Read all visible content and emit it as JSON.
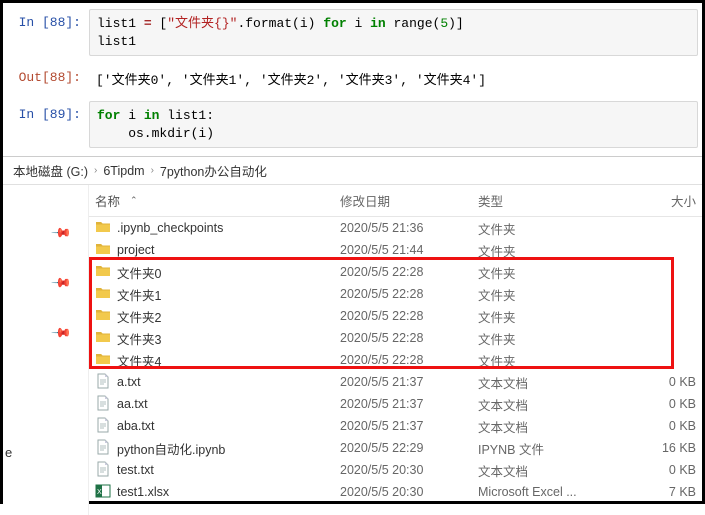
{
  "cells": {
    "in88_prompt": "In  [88]:",
    "in88_code_html": "list1 <span class='tok-op'>=</span> [<span class='tok-str'>\"文件夹{}\"</span>.format(i) <span class='tok-kw'>for</span> i <span class='tok-kw'>in</span> range(<span class='tok-num'>5</span>)]\nlist1",
    "out88_prompt": "Out[88]:",
    "out88_text": "['文件夹0', '文件夹1', '文件夹2', '文件夹3', '文件夹4']",
    "in89_prompt": "In  [89]:",
    "in89_code_html": "<span class='tok-kw'>for</span> i <span class='tok-kw'>in</span> list1:\n    os.mkdir(i)"
  },
  "breadcrumb": {
    "items": [
      "本地磁盘 (G:)",
      "6Tipdm",
      "7python办公自动化"
    ]
  },
  "columns": {
    "name": "名称",
    "date": "修改日期",
    "type": "类型",
    "size": "大小"
  },
  "files": [
    {
      "icon": "folder",
      "name": ".ipynb_checkpoints",
      "date": "2020/5/5 21:36",
      "type": "文件夹",
      "size": ""
    },
    {
      "icon": "folder",
      "name": "project",
      "date": "2020/5/5 21:44",
      "type": "文件夹",
      "size": ""
    },
    {
      "icon": "folder",
      "name": "文件夹0",
      "date": "2020/5/5 22:28",
      "type": "文件夹",
      "size": ""
    },
    {
      "icon": "folder",
      "name": "文件夹1",
      "date": "2020/5/5 22:28",
      "type": "文件夹",
      "size": ""
    },
    {
      "icon": "folder",
      "name": "文件夹2",
      "date": "2020/5/5 22:28",
      "type": "文件夹",
      "size": ""
    },
    {
      "icon": "folder",
      "name": "文件夹3",
      "date": "2020/5/5 22:28",
      "type": "文件夹",
      "size": ""
    },
    {
      "icon": "folder",
      "name": "文件夹4",
      "date": "2020/5/5 22:28",
      "type": "文件夹",
      "size": ""
    },
    {
      "icon": "txt",
      "name": "a.txt",
      "date": "2020/5/5 21:37",
      "type": "文本文档",
      "size": "0 KB"
    },
    {
      "icon": "txt",
      "name": "aa.txt",
      "date": "2020/5/5 21:37",
      "type": "文本文档",
      "size": "0 KB"
    },
    {
      "icon": "txt",
      "name": "aba.txt",
      "date": "2020/5/5 21:37",
      "type": "文本文档",
      "size": "0 KB"
    },
    {
      "icon": "ipynb",
      "name": "python自动化.ipynb",
      "date": "2020/5/5 22:29",
      "type": "IPYNB 文件",
      "size": "16 KB"
    },
    {
      "icon": "txt",
      "name": "test.txt",
      "date": "2020/5/5 20:30",
      "type": "文本文档",
      "size": "0 KB"
    },
    {
      "icon": "xlsx",
      "name": "test1.xlsx",
      "date": "2020/5/5 20:30",
      "type": "Microsoft Excel ...",
      "size": "7 KB"
    }
  ],
  "highlight": {
    "start_index": 2,
    "end_index": 6
  }
}
